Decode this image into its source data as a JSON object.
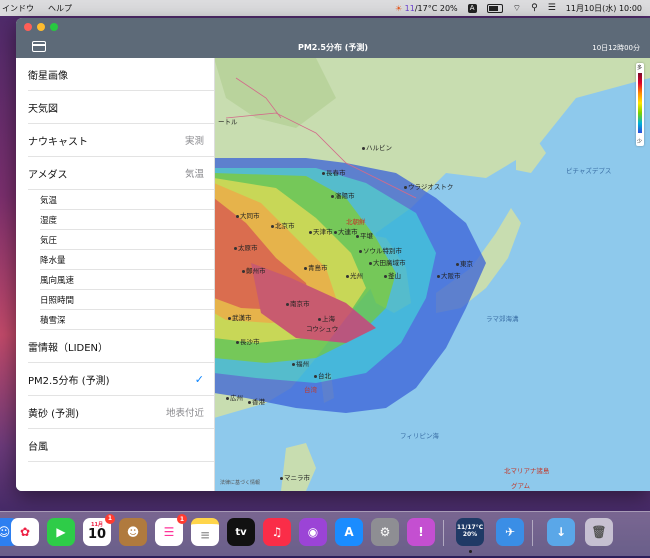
{
  "menubar": {
    "items": [
      "インドウ",
      "ヘルプ"
    ],
    "weather": {
      "hi": "11",
      "rest": "/17°C 20%"
    },
    "ime": "A",
    "datetime": "11月10日(水) 10:00"
  },
  "window": {
    "title": "PM2.5分布 (予測)",
    "timestamp": "10日12時00分"
  },
  "scale": {
    "top": "多",
    "bottom": "少"
  },
  "menu": {
    "items": [
      {
        "label": "衛星画像",
        "value": ""
      },
      {
        "label": "天気図",
        "value": ""
      },
      {
        "label": "ナウキャスト",
        "value": "実測"
      },
      {
        "label": "アメダス",
        "value": "気温"
      }
    ],
    "amedas_sub": [
      "気温",
      "湿度",
      "気圧",
      "降水量",
      "風向風速",
      "日照時間",
      "積雪深"
    ],
    "items2": [
      {
        "label": "雷情報（LIDEN）",
        "value": ""
      },
      {
        "label": "PM2.5分布 (予測)",
        "value": "✓"
      },
      {
        "label": "黄砂 (予測)",
        "value": "地表付近"
      },
      {
        "label": "台風",
        "value": ""
      }
    ]
  },
  "map_labels": {
    "torte": "ートル",
    "harbin": "ハルビン",
    "changchun": "長春市",
    "shenyang": "瀋陽市",
    "vladivostok": "ウラジオストク",
    "pichaz": "ピチャズデプス",
    "datong": "大同市",
    "beijing": "北京市",
    "tianjin": "天津市",
    "dalian": "大連市",
    "pyongyang": "平壌",
    "northkorea": "北朝鮮",
    "seoul": "ソウル特別市",
    "daejeon": "大田廣域市",
    "taiyuan": "太原市",
    "zhengzhou": "鄭州市",
    "qingdao": "青島市",
    "gwangju": "光州",
    "busan": "釜山",
    "osaka": "大阪市",
    "tokyo": "東京",
    "nanjing": "南京市",
    "wuhan": "武漢市",
    "shanghai": "上海",
    "shanghai2": "コウシュウ",
    "changsha": "長沙市",
    "fuzhou": "福州",
    "taipei": "台北",
    "taiwan": "台湾",
    "guangzhou": "広州",
    "hongkong": "香港",
    "philippines": "フィリピン海",
    "mariana_sea": "ラマ郊海溝",
    "mariana": "北マリアナ諸島",
    "guam": "グアム",
    "manila": "マニラ市",
    "attrib": "法律に基づく情報"
  },
  "dock": {
    "calendar_month": "11月",
    "calendar_day": "10",
    "calendar_badge": "1",
    "reminders_badge": "1",
    "tv": "tv",
    "mini_weather": "11/17°C",
    "mini_pct": "20%"
  }
}
